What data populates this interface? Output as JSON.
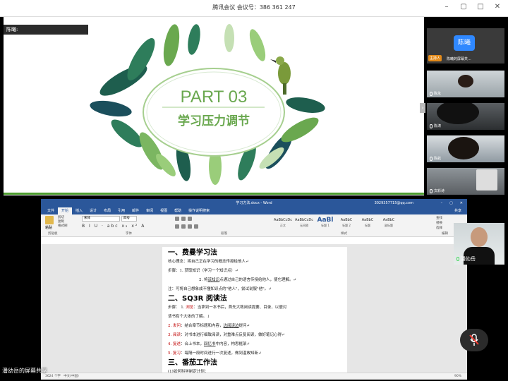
{
  "window": {
    "title": "腾讯会议  会议号：386 361 247",
    "controls": [
      "minimize",
      "restore",
      "maximize",
      "close"
    ]
  },
  "slide": {
    "speaker_tag": "陈曦:",
    "part_label": "PART 03",
    "title": "学习压力调节",
    "accent_color": "#4c9c2e",
    "text_color": "#6aa84f"
  },
  "participants": {
    "host": {
      "avatar_text": "陈曦",
      "badge": "主持人",
      "name": "陈曦的屏幕共..."
    },
    "others": [
      {
        "name": "陈永"
      },
      {
        "name": "陈涛"
      },
      {
        "name": "陈航"
      },
      {
        "name": "文彩诗"
      }
    ]
  },
  "word": {
    "title": "学习方法.docx - Word",
    "account": "3029357715@qq.com",
    "tabs": [
      "文件",
      "开始",
      "插入",
      "设计",
      "布局",
      "引用",
      "邮件",
      "审阅",
      "视图",
      "帮助",
      "操作说明搜索"
    ],
    "active_tab": "开始",
    "share_label": "共享",
    "ribbon": {
      "paste": "粘贴",
      "clipboard_items": [
        "剪切",
        "复制",
        "格式刷"
      ],
      "font_name": "宋体",
      "font_size": "四号",
      "groups": [
        "剪贴板",
        "字体",
        "段落",
        "样式",
        "编辑"
      ],
      "styles": [
        {
          "preview": "AaBbCcDc",
          "name": "正文"
        },
        {
          "preview": "AaBbCcDc",
          "name": "无间隔"
        },
        {
          "preview": "AaBl",
          "name": "标题 1"
        },
        {
          "preview": "AaBbC",
          "name": "标题 2"
        },
        {
          "preview": "AaBbC",
          "name": "标题"
        },
        {
          "preview": "AaBbC",
          "name": "副标题"
        }
      ],
      "editing": [
        "查找",
        "替换",
        "选择"
      ]
    },
    "doc": {
      "h1": "一、费曼学习法",
      "l1": "核心理念：将自己正在学习的概念传授给他人↵",
      "l2": "步骤：1. 获取知识（学习一个知识点）↵",
      "l3a": "2. 将",
      "l3u": "该知识",
      "l3b": "点通过自己的语言传授给他人，使它理解。↵",
      "l4": "注：可将自己想象成不懂知识点的\"他人\"，尝试说服\"他\"。↵",
      "h2": "二、SQ3R 阅读法",
      "l5a": "步骤：  1. ",
      "l5r": "浏览",
      "l5b": "：当拿到一本书后，首先大致阅读提要、目录，以便对",
      "l6": "该书有个大体的了解。↓",
      "l7r": "2. 发问",
      "l7a": "：结合章节标题和内容，",
      "l7u": "边阅读边",
      "l7b": "提问↵",
      "l8r": "3. 阅读",
      "l8a": "：对书本进行细致阅读，对重难点反复阅读，做好笔记心得↵",
      "l9r": "4. 复述",
      "l9a": "：合上书本，",
      "l9u": "回忆书",
      "l9b": "中内容，构思框架↵",
      "l10r": "5. 复习",
      "l10a": "：每隔一段时间进行一次复述，做到温故知新↵",
      "h3": "三、番茄工作法",
      "l11": "(1)如何科学制定计划："
    },
    "status": {
      "words": "3624 个字",
      "lang": "中文(中国)",
      "zoom": "90%"
    }
  },
  "presenter": {
    "name": "潘幼岳"
  },
  "share_label": "潘幼岳的屏幕共享"
}
